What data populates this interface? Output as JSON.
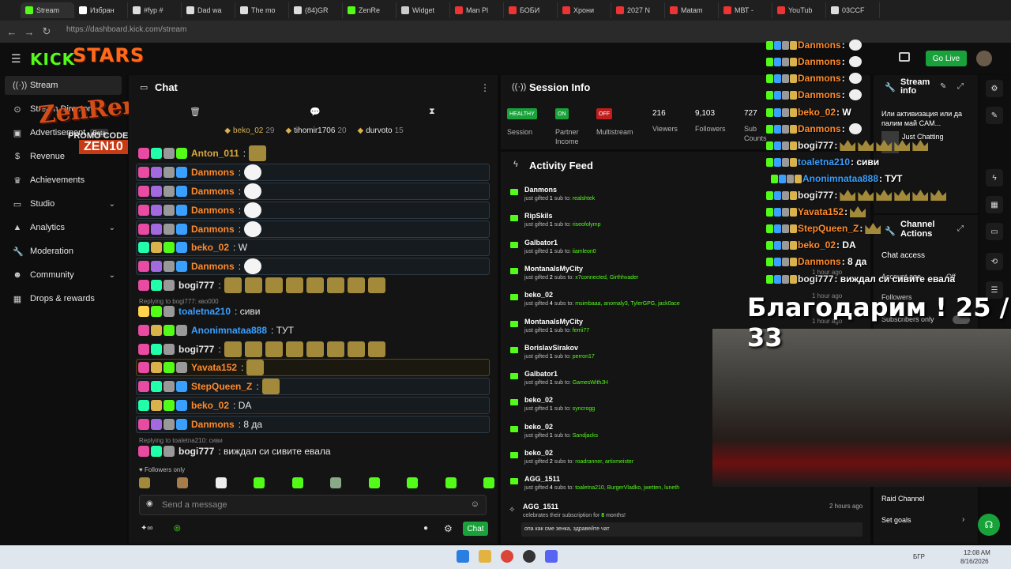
{
  "browser": {
    "tabs": [
      "Stream",
      "Избран",
      "#fyp #",
      "Dad wa",
      "The mo",
      "(84)GR",
      "ZenRe",
      "Widget",
      "Man Pl",
      "БОБИ",
      "Хрони",
      "2027 N",
      "Matam",
      "МВТ -",
      "YouTub",
      "03CCF"
    ],
    "url": "https://dashboard.kick.com/stream"
  },
  "header": {
    "logo": "KICK",
    "overlay_brand": "STARS",
    "go_live": "Go Live"
  },
  "sidebar": {
    "items": [
      {
        "label": "Stream",
        "icon": "radio-icon"
      },
      {
        "label": "Stream Directory",
        "icon": "link-icon"
      },
      {
        "label": "Advertisement",
        "icon": "ad-icon",
        "badge": "Beta"
      },
      {
        "label": "Revenue",
        "icon": "dollar-icon"
      },
      {
        "label": "Achievements",
        "icon": "trophy-icon"
      },
      {
        "label": "Studio",
        "icon": "monitor-icon"
      },
      {
        "label": "Analytics",
        "icon": "chart-icon"
      },
      {
        "label": "Moderation",
        "icon": "wrench-icon"
      },
      {
        "label": "Community",
        "icon": "people-icon"
      },
      {
        "label": "Drops & rewards",
        "icon": "gift-icon"
      }
    ],
    "overlay_text": "ZenRemasta",
    "promo_label": "PROMO CODE",
    "promo_code": "ZEN10"
  },
  "chat": {
    "title": "Chat",
    "pinned": [
      {
        "user": "beko_02",
        "count": "29"
      },
      {
        "user": "tihomir1706",
        "count": "20"
      },
      {
        "user": "durvoto",
        "count": "15"
      }
    ],
    "messages": [
      {
        "user": "Anton_011",
        "text": ":",
        "color": "#d9a73a"
      },
      {
        "user": "Danmons",
        "text": ":",
        "color": "#ff8a2a"
      },
      {
        "user": "Danmons",
        "text": ":",
        "color": "#ff8a2a"
      },
      {
        "user": "Danmons",
        "text": ":",
        "color": "#ff8a2a"
      },
      {
        "user": "Danmons",
        "text": ":",
        "color": "#ff8a2a"
      },
      {
        "user": "beko_02",
        "text": ": W",
        "color": "#ff8a2a"
      },
      {
        "user": "Danmons",
        "text": ":",
        "color": "#ff8a2a"
      },
      {
        "user": "bogi777",
        "text": ":",
        "color": "#e8e8e8"
      },
      {
        "user": "toaletna210",
        "text": ": сиви",
        "color": "#3aa0ff"
      },
      {
        "user": "Anonimnataa888",
        "text": ": ТУТ",
        "color": "#3aa0ff"
      },
      {
        "user": "bogi777",
        "text": ":",
        "color": "#e8e8e8"
      },
      {
        "user": "Yavata152",
        "text": ":",
        "color": "#ff8a2a"
      },
      {
        "user": "StepQueen_Z",
        "text": ":",
        "color": "#ff8a2a"
      },
      {
        "user": "beko_02",
        "text": ": DA",
        "color": "#ff8a2a"
      },
      {
        "user": "Danmons",
        "text": ": 8 да",
        "color": "#ff8a2a"
      },
      {
        "user": "bogi777",
        "text": ": виждал си сивите евала",
        "color": "#e8e8e8"
      }
    ],
    "reply1": "Replying to bogi777: кво000",
    "reply2": "Replying to toaletna210: сиви",
    "followers_only": "Followers only",
    "input_placeholder": "Send a message",
    "send_label": "Chat"
  },
  "session": {
    "title": "Session Info",
    "stats": [
      {
        "pill": "HEALTHY",
        "label": "Session",
        "color": "#1aa23a"
      },
      {
        "pill": "ON",
        "label": "Partner Income",
        "color": "#1aa23a"
      },
      {
        "pill": "OFF",
        "label": "Multistream",
        "color": "#c21d1d"
      }
    ],
    "viewers": {
      "value": "216",
      "label": "Viewers"
    },
    "followers": {
      "value": "9,103",
      "label": "Followers"
    },
    "subs": {
      "value": "727",
      "label": "Sub Counts"
    }
  },
  "activity": {
    "title": "Activity Feed",
    "items": [
      {
        "user": "Danmons",
        "prefix": "just gifted ",
        "count": "1",
        "mid": " sub to: ",
        "target": "realshtek"
      },
      {
        "user": "RipSkils",
        "prefix": "just gifted ",
        "count": "1",
        "mid": " sub to: ",
        "target": "riseofolymp"
      },
      {
        "user": "Galbator1",
        "prefix": "just gifted ",
        "count": "1",
        "mid": " sub to: ",
        "target": "iiamleon0"
      },
      {
        "user": "MontanalsMyCity",
        "prefix": "just gifted ",
        "count": "2",
        "mid": " subs to: ",
        "target": "x7connected, Girthhvader"
      },
      {
        "user": "beko_02",
        "prefix": "just gifted ",
        "count": "4",
        "mid": " subs to: ",
        "target": "msimbaaa, anomaly3, TylerGPG, jack0ace"
      },
      {
        "user": "MontanalsMyCity",
        "prefix": "just gifted ",
        "count": "1",
        "mid": " sub to: ",
        "target": "ferrii77"
      },
      {
        "user": "BorislavSirakov",
        "prefix": "just gifted ",
        "count": "1",
        "mid": " sub to: ",
        "target": "perron17"
      },
      {
        "user": "Galbator1",
        "prefix": "just gifted ",
        "count": "1",
        "mid": " sub to: ",
        "target": "GamesWithJH"
      },
      {
        "user": "beko_02",
        "prefix": "just gifted ",
        "count": "1",
        "mid": " sub to: ",
        "target": "syncrogg"
      },
      {
        "user": "beko_02",
        "prefix": "just gifted ",
        "count": "1",
        "mid": " sub to: ",
        "target": "Sandjacks"
      },
      {
        "user": "beko_02",
        "prefix": "just gifted ",
        "count": "2",
        "mid": " subs to: ",
        "target": "roadranner, artixmeister"
      },
      {
        "user": "AGG_1511",
        "prefix": "just gifted ",
        "count": "4",
        "mid": " subs to: ",
        "target": "toaletna210, BurgerVladko, jwetten, luneth"
      }
    ],
    "resub": {
      "user": "AGG_1511",
      "time": "2 hours ago",
      "text_a": "celebrates their subscription for ",
      "months": "8",
      "text_b": " months!",
      "message": "опа как сме зенка, здравейте чат"
    },
    "times": [
      "1 hour ago",
      "1 hour ago",
      "1 hour ago"
    ]
  },
  "stream_info": {
    "title": "Stream info",
    "text": "Или активизация или да палим май CAM...",
    "category": "Just Chatting"
  },
  "channel_actions": {
    "title": "Channel Actions",
    "items": [
      "Chat access",
      "Account age",
      "Followers",
      "Subscribers only",
      "Raid Channel",
      "Set goals"
    ],
    "account_age_value": "Off"
  },
  "overlay_chat": [
    {
      "user": "Danmons",
      "text": " :",
      "color": "#ff8a2a"
    },
    {
      "user": "Danmons",
      "text": " :",
      "color": "#ff8a2a"
    },
    {
      "user": "Danmons",
      "text": " :",
      "color": "#ff8a2a"
    },
    {
      "user": "Danmons",
      "text": " :",
      "color": "#ff8a2a"
    },
    {
      "user": "beko_02",
      "text": " : W",
      "color": "#ff8a2a"
    },
    {
      "user": "Danmons",
      "text": " :",
      "color": "#ff8a2a"
    },
    {
      "user": "bogi777",
      "text": " :",
      "color": "#e8e8e8"
    },
    {
      "user": "toaletna210",
      "text": " : сиви",
      "color": "#3aa0ff"
    },
    {
      "user": "Anonimnataa888",
      "text": " : ТУТ",
      "color": "#3aa0ff"
    },
    {
      "user": "bogi777",
      "text": " :",
      "color": "#e8e8e8"
    },
    {
      "user": "Yavata152",
      "text": " :",
      "color": "#ff8a2a"
    },
    {
      "user": "StepQueen_Z",
      "text": " :",
      "color": "#ff8a2a"
    },
    {
      "user": "beko_02",
      "text": " : DA",
      "color": "#ff8a2a"
    },
    {
      "user": "Danmons",
      "text": " : 8 да",
      "color": "#ff8a2a"
    },
    {
      "user": "bogi777",
      "text": " : виждал си сивите евала",
      "color": "#e8e8e8"
    }
  ],
  "overlay_goal": "Благодарим ! 25 / 33",
  "taskbar": {
    "time": "12:08 AM",
    "date": "8/16/2026",
    "lang": "БГР"
  }
}
